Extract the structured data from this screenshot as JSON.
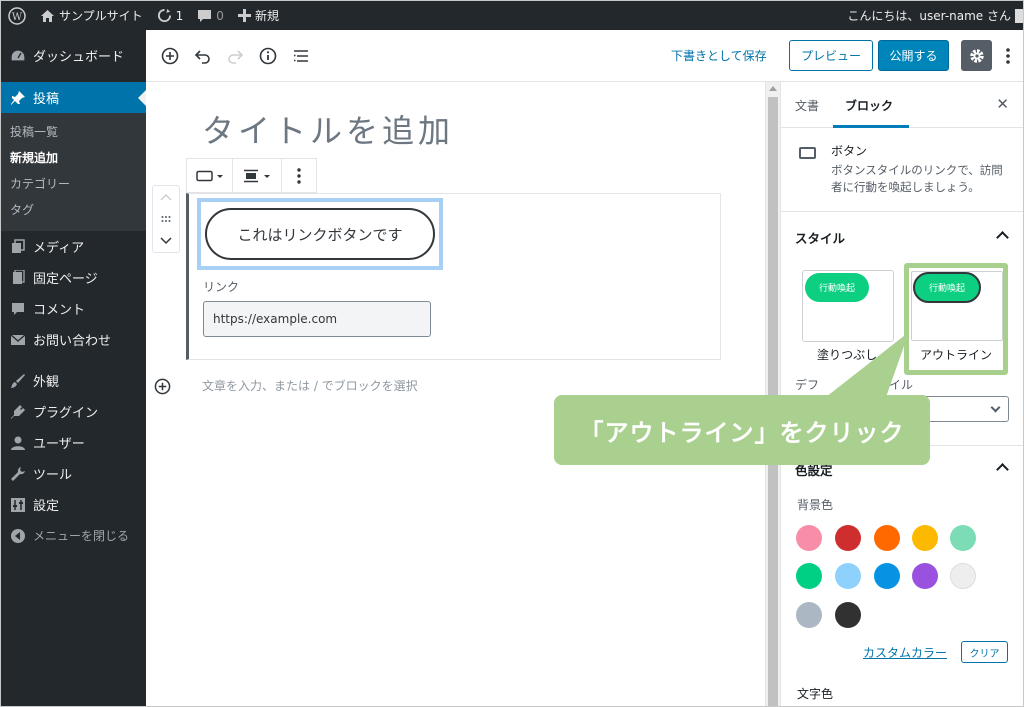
{
  "admin_bar": {
    "site_name": "サンプルサイト",
    "updates_count": "1",
    "comments_count": "0",
    "new_label": "新規",
    "greeting": "こんにちは、user-name さん"
  },
  "sidebar": {
    "items": [
      {
        "label": "ダッシュボード",
        "icon": "dashboard-icon"
      },
      {
        "label": "投稿",
        "icon": "pin-icon",
        "active": true
      },
      {
        "label": "メディア",
        "icon": "media-icon"
      },
      {
        "label": "固定ページ",
        "icon": "page-icon"
      },
      {
        "label": "コメント",
        "icon": "comment-icon"
      },
      {
        "label": "お問い合わせ",
        "icon": "mail-icon"
      },
      {
        "label": "外観",
        "icon": "brush-icon"
      },
      {
        "label": "プラグイン",
        "icon": "plugin-icon"
      },
      {
        "label": "ユーザー",
        "icon": "user-icon"
      },
      {
        "label": "ツール",
        "icon": "wrench-icon"
      },
      {
        "label": "設定",
        "icon": "settings-icon"
      },
      {
        "label": "メニューを閉じる",
        "icon": "collapse-icon"
      }
    ],
    "submenu": [
      "投稿一覧",
      "新規追加",
      "カテゴリー",
      "タグ"
    ]
  },
  "toolbar": {
    "save_draft": "下書きとして保存",
    "preview": "プレビュー",
    "publish": "公開する"
  },
  "editor": {
    "title_placeholder": "タイトルを追加",
    "button_text": "これはリンクボタンです",
    "link_label": "リンク",
    "link_value": "https://example.com",
    "appender_placeholder": "文章を入力、または / でブロックを選択"
  },
  "panel": {
    "tabs": [
      "文書",
      "ブロック"
    ],
    "block_name": "ボタン",
    "block_description": "ボタンスタイルのリンクで、訪問者に行動を喚起しましょう。",
    "style_heading": "スタイル",
    "styles": [
      {
        "preview_text": "行動喚起",
        "label": "塗りつぶし"
      },
      {
        "preview_text": "行動喚起",
        "label": "アウトライン",
        "selected": true
      }
    ],
    "default_style_label_visible": "デフ",
    "default_style_label_tail": "タイル",
    "color_heading_visible": "色設定",
    "background_color_label": "背景色",
    "swatches": [
      "#f78da7",
      "#cf2e2e",
      "#ff6900",
      "#fcb900",
      "#7bdcb5",
      "#00d084",
      "#8ed1fc",
      "#0693e3",
      "#9b51e0",
      "#eeeeee",
      "#abb8c3",
      "#313131"
    ],
    "custom_color": "カスタムカラー",
    "clear": "クリア",
    "text_color_label": "文字色"
  },
  "callout": {
    "text": "「アウトライン」をクリック"
  },
  "colors": {
    "accent": "#0073aa",
    "admin_dark": "#23282d",
    "callout_green": "#a9d08e"
  }
}
